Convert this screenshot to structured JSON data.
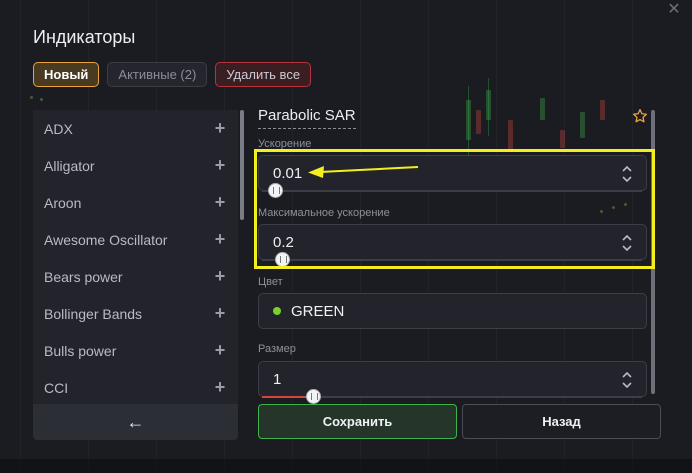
{
  "dialog": {
    "title": "Индикаторы",
    "close_icon": "close-icon"
  },
  "tabs": [
    {
      "label": "Новый",
      "active": true
    },
    {
      "label": "Активные (2)",
      "active": false
    },
    {
      "label": "Удалить все",
      "active": false
    }
  ],
  "indicator_list": [
    {
      "label": "ADX"
    },
    {
      "label": "Alligator"
    },
    {
      "label": "Aroon"
    },
    {
      "label": "Awesome Oscillator"
    },
    {
      "label": "Bears power"
    },
    {
      "label": "Bollinger Bands"
    },
    {
      "label": "Bulls power"
    },
    {
      "label": "CCI"
    }
  ],
  "back_button": {
    "icon": "arrow-left-icon",
    "label": "←"
  },
  "settings": {
    "title": "Parabolic SAR",
    "favorite_icon": "star-icon",
    "fields": {
      "acceleration": {
        "label": "Ускорение",
        "value": "0.01",
        "slider_level": 0.02
      },
      "max_acceleration": {
        "label": "Максимальное ускорение",
        "value": "0.2",
        "slider_level": 0.05
      },
      "color": {
        "label": "Цвет",
        "value": "GREEN",
        "swatch": "#7bd12a"
      },
      "size": {
        "label": "Размер",
        "value": "1",
        "slider_level": 0.12
      }
    },
    "save_label": "Сохранить",
    "cancel_label": "Назад"
  },
  "colors": {
    "accent_orange": "#e8a33d",
    "danger_red": "#b8323c",
    "save_green": "#3fb34a",
    "annotation_yellow": "#f5ee1f"
  }
}
